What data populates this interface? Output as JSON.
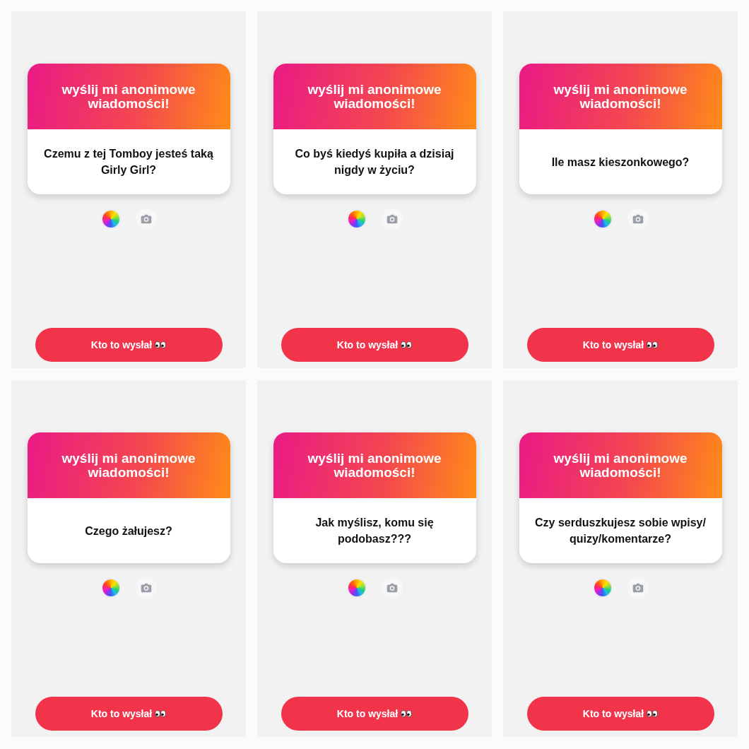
{
  "panels": [
    {
      "header": "wyślij mi anonimowe wiadomości!",
      "question": "Czemu z tej Tomboy jesteś taką Girly Girl?",
      "button": "Kto to wysłał"
    },
    {
      "header": "wyślij mi anonimowe wiadomości!",
      "question": "Co byś kiedyś kupiła a dzisiaj nigdy w życiu?",
      "button": "Kto to wysłał"
    },
    {
      "header": "wyślij mi anonimowe wiadomości!",
      "question": "Ile masz kieszonkowego?",
      "button": "Kto to wysłał"
    },
    {
      "header": "wyślij mi anonimowe wiadomości!",
      "question": "Czego żałujesz?",
      "button": "Kto to wysłał"
    },
    {
      "header": "wyślij mi anonimowe wiadomości!",
      "question": "Jak myślisz, komu się podobasz???",
      "button": "Kto to wysłał"
    },
    {
      "header": "wyślij mi anonimowe wiadomości!",
      "question": "Czy serduszkujesz sobie wpisy/quizy/komentarze?",
      "button": "Kto to wysłał"
    }
  ]
}
